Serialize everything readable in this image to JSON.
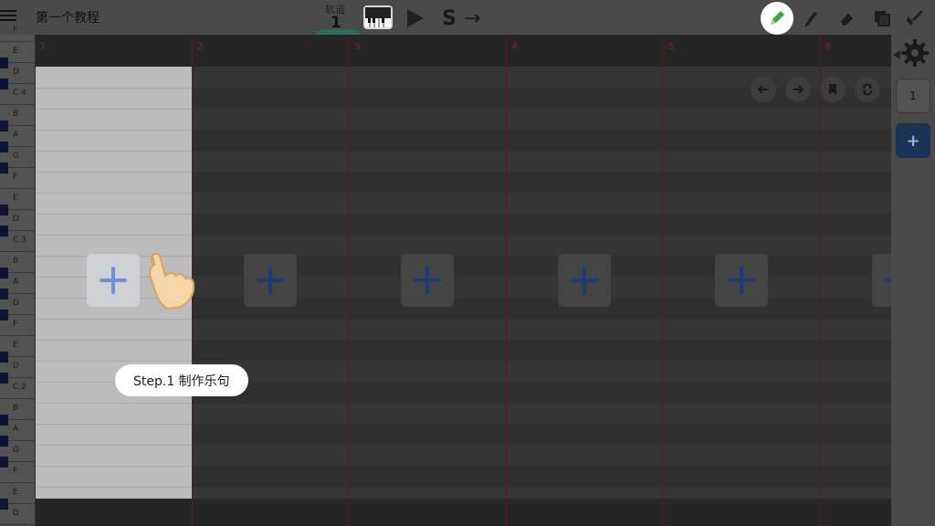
{
  "app": {
    "title": "第一个教程",
    "track_label": "轨道",
    "track_number": "1"
  },
  "toolbar": {
    "tools": [
      "pencil-icon",
      "brush-icon",
      "eraser-icon",
      "copy-icon",
      "pick-icon"
    ],
    "active_tool": "pencil-icon",
    "active_color": "#2fa84f"
  },
  "keyboard": {
    "keys": [
      "F",
      "E",
      "D",
      "C 4",
      "B",
      "A",
      "G",
      "F",
      "E",
      "D",
      "C 3",
      "B",
      "A",
      "G",
      "F",
      "E",
      "D",
      "C 2",
      "B",
      "A",
      "G",
      "F",
      "E",
      "D"
    ]
  },
  "grid": {
    "bars": [
      "1",
      "2",
      "3",
      "4",
      "5",
      "6"
    ],
    "add_buttons": 6,
    "active_bar": 1
  },
  "tooltip": {
    "text": "Step.1 制作乐句"
  },
  "right_panel": {
    "segment_number": "1",
    "add_label": "+"
  }
}
